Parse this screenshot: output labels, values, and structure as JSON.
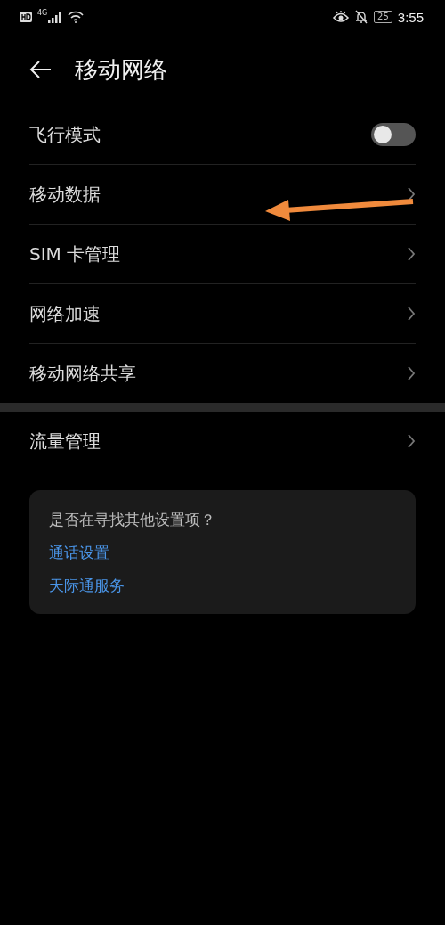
{
  "status_bar": {
    "network": "4G",
    "battery": "25",
    "time": "3:55"
  },
  "header": {
    "title": "移动网络"
  },
  "section_1": [
    {
      "kind": "toggle",
      "label": "飞行模式",
      "on": false
    },
    {
      "kind": "link",
      "label": "移动数据"
    },
    {
      "kind": "link",
      "label": "SIM 卡管理"
    },
    {
      "kind": "link",
      "label": "网络加速"
    },
    {
      "kind": "link",
      "label": "移动网络共享"
    }
  ],
  "section_2": [
    {
      "kind": "link",
      "label": "流量管理"
    }
  ],
  "suggestions": {
    "question": "是否在寻找其他设置项？",
    "links": [
      "通话设置",
      "天际通服务"
    ]
  }
}
